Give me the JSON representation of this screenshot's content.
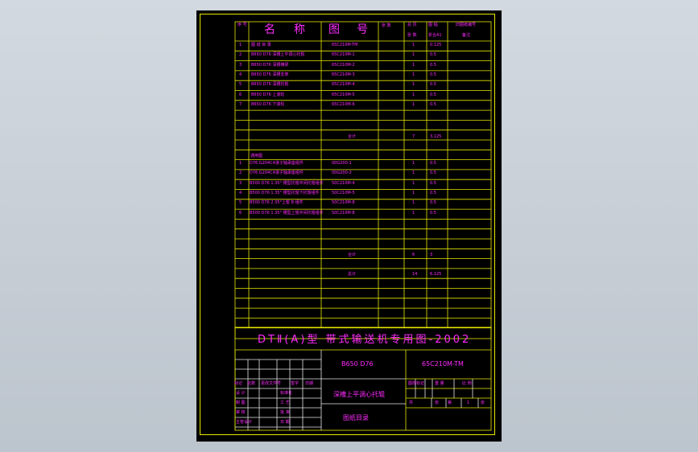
{
  "header": {
    "seq": "序\n号",
    "name_a": "名",
    "name_b": "称",
    "drawing_a": "图",
    "drawing_b": "号",
    "sub": "张 数",
    "pages": "总 页",
    "pages2": "张 数",
    "size": "图 幅",
    "size2": "折合A1",
    "remark": "旧图纸编号",
    "remark2": "备注"
  },
  "rows_a": [
    {
      "n": "1",
      "name": "图 纸 目 录",
      "code": "65C210M-TM",
      "qty": "1",
      "a1": "0.125"
    },
    {
      "n": "2",
      "name": "B650 D76 深槽上平调心托辊",
      "code": "65C210M-1",
      "qty": "1",
      "a1": "0.5"
    },
    {
      "n": "3",
      "name": "B650 D76 深槽横梁",
      "code": "65C210M-2",
      "qty": "1",
      "a1": "0.5"
    },
    {
      "n": "4",
      "name": "B650 D76 深槽支架",
      "code": "65C210M-3",
      "qty": "1",
      "a1": "0.5"
    },
    {
      "n": "5",
      "name": "B650 D76 深槽托辊",
      "code": "65C210M-4",
      "qty": "1",
      "a1": "0.5"
    },
    {
      "n": "6",
      "name": "B650 D76 上滚轮",
      "code": "65C210M-5",
      "qty": "1",
      "a1": "0.5"
    },
    {
      "n": "7",
      "name": "B650 D76 下滚轮",
      "code": "65C210M-6",
      "qty": "1",
      "a1": "0.5"
    }
  ],
  "subtotal_a": {
    "label": "合计",
    "qty": "7",
    "a1": "3.125"
  },
  "section_b_title": "通用图",
  "rows_b": [
    {
      "n": "1",
      "name": "D76 G204C4滚子轴承座组件",
      "code": "00G200-1",
      "qty": "1",
      "a1": "0.5"
    },
    {
      "n": "2",
      "name": "D76 G204C4滚子轴承座组件",
      "code": "00G200-2",
      "qty": "1",
      "a1": "0.5"
    },
    {
      "n": "3",
      "name": "B500 D76 1.35° 槽型托辊中间托辊组件",
      "code": "50C210M-4",
      "qty": "1",
      "a1": "0.5"
    },
    {
      "n": "4",
      "name": "B500 D76 1.35° 槽型托辊下托辊组件",
      "code": "50C210M-5",
      "qty": "1",
      "a1": "0.5"
    },
    {
      "n": "5",
      "name": "B500 D76 2.35°上辊 B 组件",
      "code": "50C210M-8",
      "qty": "1",
      "a1": "0.5"
    },
    {
      "n": "6",
      "name": "B500 D76 1.35° 槽型上辊中间托辊组件",
      "code": "50C210M-8",
      "qty": "1",
      "a1": "0.5"
    }
  ],
  "subtotal_b": {
    "label": "合计",
    "qty": "6",
    "a1": "3"
  },
  "total": {
    "label": "总计",
    "qty": "14",
    "a1": "6.125"
  },
  "title_block": {
    "series": "DTⅡ(A)型  带式输送机专用图-2002",
    "spec": "B650 D76",
    "code": "65C210M-TM",
    "desc": "深槽上平调心托辊",
    "doc": "图纸目录",
    "rev_h1": "标记",
    "rev_h2": "处数",
    "rev_h3": "更改文件号",
    "rev_h4": "签字",
    "rev_h5": "日期",
    "design": "设 计",
    "check": "审 核",
    "process": "工 艺",
    "approve": "批 准",
    "std": "标准化",
    "date": "日 期",
    "draw": "制 图",
    "prj": "主管设计",
    "stage": "图样标记",
    "weight": "重 量",
    "scale": "比 例",
    "total_sheets": "共",
    "sheet": "张",
    "no": "第",
    "page1": "1",
    "page2": "张"
  }
}
